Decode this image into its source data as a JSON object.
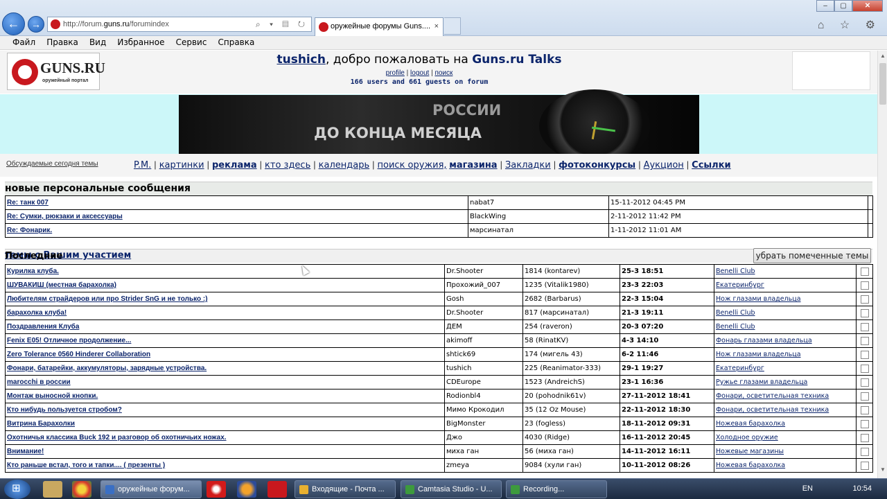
{
  "browser": {
    "url_prefix": "http://forum.",
    "url_domain": "guns.ru",
    "url_path": "/forumindex",
    "url_controls": "⌕ ▾ ▤ ↻",
    "tab_title": "оружейные форумы Guns....",
    "tab_close": "×",
    "win_min": "–",
    "win_max": "▢",
    "win_close": "✕",
    "right_icons": "⌂ ☆ ⚙",
    "back": "←",
    "forward": "→"
  },
  "menu": [
    "Файл",
    "Правка",
    "Вид",
    "Избранное",
    "Сервис",
    "Справка"
  ],
  "header": {
    "logo_name": "GUNS.RU",
    "logo_sub": "оружейный портал",
    "username": "tushich",
    "welcome_text": ", добро пожаловать на ",
    "site_name": "Guns.ru Talks",
    "links": [
      "profile",
      "logout",
      "поиск"
    ],
    "link_sep": "|",
    "online": "166 users and 661 guests on forum"
  },
  "banner": {
    "line1": "РОССИИ",
    "line2": "ДО КОНЦА МЕСЯЦА"
  },
  "nav": {
    "today_link": "Обсуждаемые сегодня темы",
    "links": [
      {
        "label": "P.M.",
        "bold": false,
        "sep": "|"
      },
      {
        "label": "картинки",
        "bold": false,
        "sep": "|"
      },
      {
        "label": "реклама",
        "bold": true,
        "sep": "|"
      },
      {
        "label": "кто здесь",
        "bold": false,
        "sep": "|"
      },
      {
        "label": "календарь",
        "bold": false,
        "sep": "|"
      },
      {
        "label": "поиск оружия,",
        "bold": false,
        "sep": ""
      },
      {
        "label": "магазина",
        "bold": true,
        "sep": "|"
      },
      {
        "label": "Закладки",
        "bold": false,
        "sep": "|"
      },
      {
        "label": "фотоконкурсы",
        "bold": true,
        "sep": "|"
      },
      {
        "label": "Аукцион",
        "bold": false,
        "sep": "|"
      },
      {
        "label": "Ссылки",
        "bold": true,
        "sep": ""
      }
    ]
  },
  "pm": {
    "heading": "новые персональные сообщения",
    "rows": [
      {
        "title": "Re: танк 007",
        "author": "nabat7",
        "date": "15-11-2012 04:45 PM"
      },
      {
        "title": "Re: Сумки, рюкзаки и аксессуары",
        "author": "BlackWing",
        "date": "2-11-2012 11:42 PM"
      },
      {
        "title": "Re: Фонарик.",
        "author": "марсинатал",
        "date": "1-11-2012 11:01 AM"
      }
    ]
  },
  "topics": {
    "heading_prefix": "Последние ",
    "heading_link": "темы с Вашим участием",
    "remove_button": "убрать помеченные темы",
    "rows": [
      {
        "title": "Курилка клуба.",
        "author": "Dr.Shooter",
        "last": "1814 (kontarev)",
        "date": "25-3 18:51",
        "forum": "Benelli Club"
      },
      {
        "title": "ШУВАКИШ (местная барахолка)",
        "author": "Прохожий_007",
        "last": "1235 (Vitalik1980)",
        "date": "23-3 22:03",
        "forum": "Екатеринбург"
      },
      {
        "title": "Любителям страйдеров или про Strider SnG и не только :)",
        "author": "Gosh",
        "last": "2682 (Barbarus)",
        "date": "22-3 15:04",
        "forum": "Нож глазами владельца"
      },
      {
        "title": "барахолка клуба!",
        "author": "Dr.Shooter",
        "last": "817 (марсинатал)",
        "date": "21-3 19:11",
        "forum": "Benelli Club"
      },
      {
        "title": "Поздравления Клуба",
        "author": "ДЕМ",
        "last": "254 (raveron)",
        "date": "20-3 07:20",
        "forum": "Benelli Club"
      },
      {
        "title": "Fenix E05! Отличное продолжение...",
        "author": "akimoff",
        "last": "58 (RinatKV)",
        "date": "4-3 14:10",
        "forum": "Фонарь глазами владельца"
      },
      {
        "title": "Zero Tolerance 0560 Hinderer Collaboration",
        "author": "shtick69",
        "last": "174 (мигель 43)",
        "date": "6-2 11:46",
        "forum": "Нож глазами владельца"
      },
      {
        "title": "Фонари, батарейки, аккумуляторы, зарядные устройства.",
        "author": "tushich",
        "last": "225 (Reanimator-333)",
        "date": "29-1 19:27",
        "forum": "Екатеринбург"
      },
      {
        "title": "marocchi в россии",
        "author": "CDEurope",
        "last": "1523 (AndreichS)",
        "date": "23-1 16:36",
        "forum": "Ружье глазами владельца"
      },
      {
        "title": "Монтаж выносной кнопки.",
        "author": "Rodionbl4",
        "last": "20 (pohodnik61v)",
        "date": "27-11-2012 18:41",
        "forum": "Фонари, осветительная техника"
      },
      {
        "title": "Кто нибудь пользуется стробом?",
        "author": "Мимо Крокодил",
        "last": "35 (12 Oz Mouse)",
        "date": "22-11-2012 18:30",
        "forum": "Фонари, осветительная техника"
      },
      {
        "title": "Витрина Барахолки",
        "author": "BigMonster",
        "last": "23 (fogless)",
        "date": "18-11-2012 09:31",
        "forum": "Ножевая барахолка"
      },
      {
        "title": "Охотничья классика Buck 192 и разговор об охотничьих ножах.",
        "author": "Джо",
        "last": "4030 (Ridge)",
        "date": "16-11-2012 20:45",
        "forum": "Холодное оружие"
      },
      {
        "title": "Внимание!",
        "author": "миха ган",
        "last": "56 (миха ган)",
        "date": "14-11-2012 16:11",
        "forum": "Ножевые магазины"
      },
      {
        "title": "Кто раньше встал, того и тапки.... ( презенты )",
        "author": "zmeya",
        "last": "9084 (хули ган)",
        "date": "10-11-2012 08:26",
        "forum": "Ножевая барахолка"
      }
    ]
  },
  "taskbar": {
    "start": "⊞",
    "tasks": [
      {
        "label": "оружейные форум...",
        "color": "#3a6fc4"
      },
      {
        "label": "Входящие - Почта ...",
        "color": "#e8b030"
      },
      {
        "label": "Camtasia Studio - U...",
        "color": "#3d9a3d"
      },
      {
        "label": "Recording...",
        "color": "#3d9a3d"
      }
    ],
    "lang": "EN",
    "clock": "10:54"
  }
}
